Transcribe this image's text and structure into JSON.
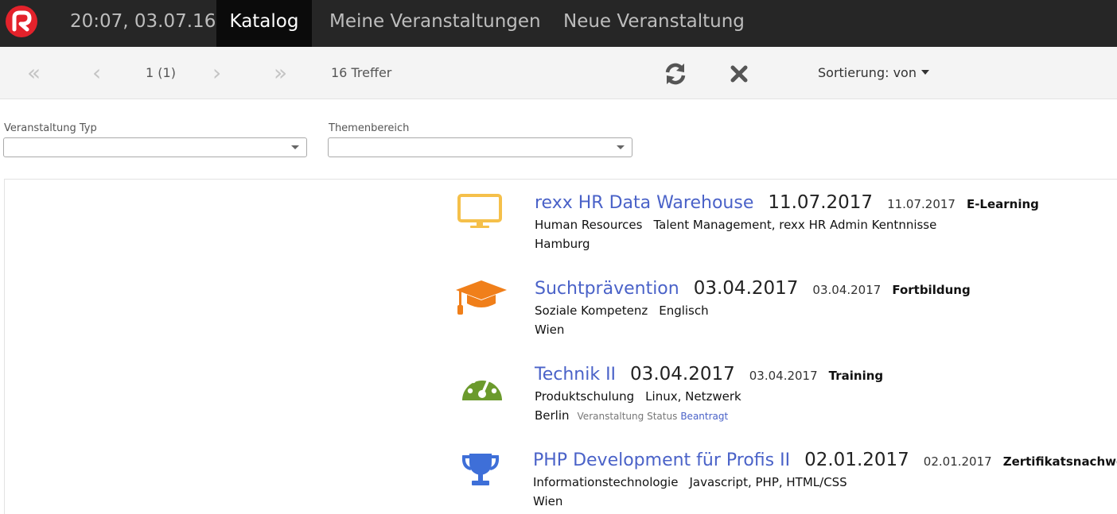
{
  "nav": {
    "logo_icon": "rexx-logo-icon",
    "datetime": "20:07, 03.07.16",
    "tabs": [
      {
        "label": "Katalog",
        "active": true
      },
      {
        "label": "Meine Veranstaltungen",
        "active": false
      },
      {
        "label": "Neue Veranstaltung",
        "active": false
      }
    ]
  },
  "toolbar": {
    "first_icon": "«",
    "prev_icon": "‹",
    "page": "1 (1)",
    "next_icon": "›",
    "last_icon": "»",
    "hits": "16 Treffer",
    "refresh_icon": "refresh-icon",
    "clear_icon": "close-icon",
    "sort_label": "Sortierung: von"
  },
  "filters": {
    "type_label": "Veranstaltung Typ",
    "type_value": "",
    "topic_label": "Themenbereich",
    "topic_value": ""
  },
  "events": [
    {
      "icon": "monitor-icon",
      "icon_color": "#f5c04a",
      "title": "rexx HR Data Warehouse",
      "date_big": "11.07.2017",
      "date_small": "11.07.2017",
      "type": "E-Learning",
      "category": "Human Resources",
      "tags": "Talent Management, rexx HR Admin Kentnnisse",
      "location": "Hamburg"
    },
    {
      "icon": "graduation-cap-icon",
      "icon_color": "#f07f1a",
      "title": "Suchtprävention",
      "date_big": "03.04.2017",
      "date_small": "03.04.2017",
      "type": "Fortbildung",
      "category": "Soziale Kompetenz",
      "tags": "Englisch",
      "location": "Wien"
    },
    {
      "icon": "dashboard-icon",
      "icon_color": "#6b9a2c",
      "title": "Technik II",
      "date_big": "03.04.2017",
      "date_small": "03.04.2017",
      "type": "Training",
      "category": "Produktschulung",
      "tags": "Linux, Netzwerk",
      "location": "Berlin",
      "status_label": "Veranstaltung Status",
      "status_value": "Beantragt"
    },
    {
      "icon": "trophy-icon",
      "icon_color": "#3e6fd8",
      "title": "PHP Development für Profis II",
      "date_big": "02.01.2017",
      "date_small": "02.01.2017",
      "type": "Zertifikatsnachweis",
      "category": "Informationstechnologie",
      "tags": "Javascript, PHP, HTML/CSS",
      "location": "Wien"
    }
  ]
}
